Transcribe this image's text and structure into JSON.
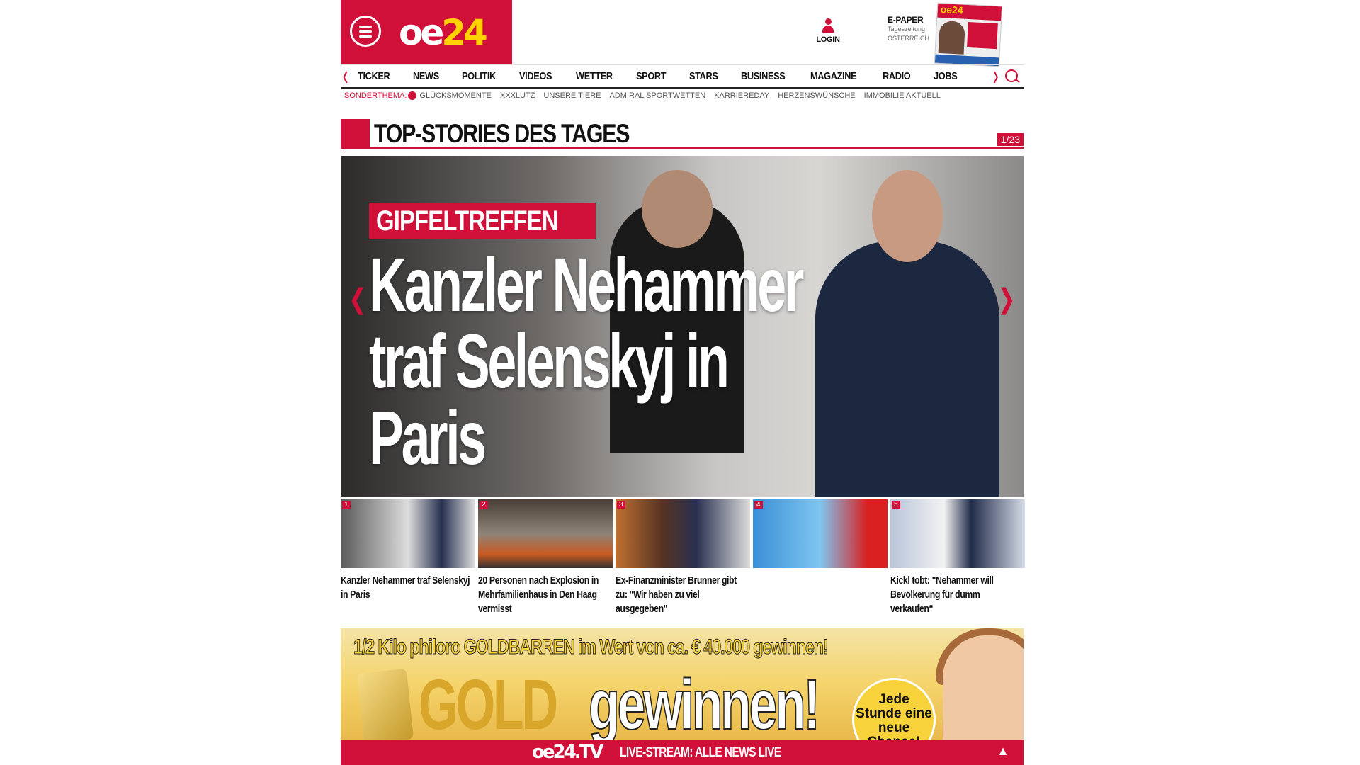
{
  "header": {
    "logo_oe": "oe",
    "logo_24": "24",
    "login_label": "LOGIN",
    "epaper_title": "E-PAPER",
    "epaper_sub1": "Tageszeitung",
    "epaper_sub2": "ÖSTERREICH"
  },
  "nav": {
    "items": [
      "TICKER",
      "NEWS",
      "POLITIK",
      "VIDEOS",
      "WETTER",
      "SPORT",
      "STARS",
      "BUSINESS",
      "MAGAZINE",
      "RADIO",
      "JOBS"
    ]
  },
  "subnav": {
    "lead": "SONDERTHEMA:",
    "items": [
      "GLÜCKSMOMENTE",
      "XXXLUTZ",
      "UNSERE TIERE",
      "ADMIRAL SPORTWETTEN",
      "KARRIEREDAY",
      "HERZENSWÜNSCHE",
      "IMMOBILIE AKTUELL"
    ]
  },
  "top_stories": {
    "title": "TOP-STORIES DES TAGES",
    "pager": "1/23"
  },
  "hero": {
    "kicker": "GIPFELTREFFEN",
    "headline": "Kanzler Nehammer traf Selenskyj in Paris"
  },
  "thumbs": [
    {
      "num": "1",
      "caption": "Kanzler Nehammer traf Selenskyj in Paris"
    },
    {
      "num": "2",
      "caption": "20 Personen nach Explosion in Mehrfamilienhaus in Den Haag vermisst"
    },
    {
      "num": "3",
      "caption": "Ex-Finanzminister Brunner gibt zu: \"Wir haben zu viel ausgegeben\""
    },
    {
      "num": "4",
      "caption": ""
    },
    {
      "num": "5",
      "caption": "Kickl tobt: \"Nehammer will Bevölkerung für dumm verkaufen“"
    }
  ],
  "ad": {
    "headline": "1/2 Kilo philoro GOLDBARREN im Wert von ca. € 40.000 gewinnen!",
    "gold": "GOLD",
    "gewinnen": "gewinnen!",
    "badge": "Jede Stunde eine neue Chance!"
  },
  "livebar": {
    "brand": "oe24.TV",
    "text": "LIVE-STREAM: ALLE NEWS LIVE"
  },
  "colors": {
    "brand_red": "#d1103a",
    "brand_yellow": "#ffd200"
  }
}
